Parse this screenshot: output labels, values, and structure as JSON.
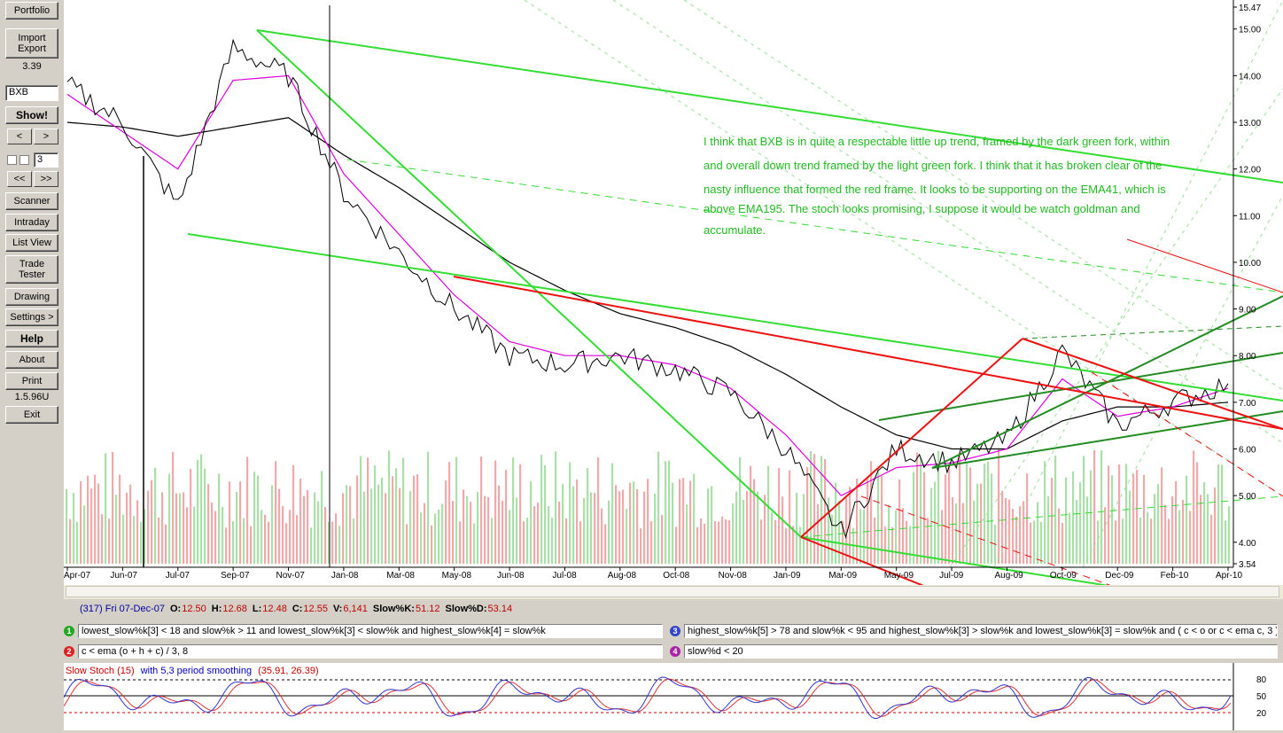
{
  "sidebar": {
    "portfolio": "Portfolio",
    "import_export_1": "Import",
    "import_export_2": "Export",
    "version_top": "3.39",
    "symbol": "BXB",
    "show": "Show!",
    "prev": "<",
    "next": ">",
    "period": "3",
    "first": "<<",
    "last": ">>",
    "scanner": "Scanner",
    "intraday": "Intraday",
    "list_view": "List View",
    "trade_tester_1": "Trade",
    "trade_tester_2": "Tester",
    "drawing": "Drawing",
    "settings": "Settings >",
    "help": "Help",
    "about": "About",
    "print": "Print",
    "version_bottom": "1.5.96U",
    "exit": "Exit"
  },
  "chart": {
    "annotation": [
      "I think that BXB is in quite a respectable little up trend, framed by the dark green fork, within",
      "and overall down trend framed by the light green fork. I think that it has broken clear of the",
      "nasty influence that formed the red frame. It looks to be supporting on the EMA41, which is",
      "above EMA195. The stoch looks promising, I suppose it would be watch goldman and",
      "accumulate."
    ],
    "price_axis": [
      "15.47",
      "15.00",
      "14.00",
      "13.00",
      "12.00",
      "11.00",
      "10.00",
      "9.00",
      "8.00",
      "7.00",
      "6.00",
      "5.00",
      "4.00",
      "3.54"
    ],
    "date_axis": [
      "Apr-07",
      "Jun-07",
      "Jul-07",
      "Sep-07",
      "Nov-07",
      "Jan-08",
      "Mar-08",
      "May-08",
      "Jun-08",
      "Jul-08",
      "Aug-08",
      "Oct-08",
      "Nov-08",
      "Jan-09",
      "Mar-09",
      "May-09",
      "Jul-09",
      "Aug-09",
      "Oct-09",
      "Dec-09",
      "Feb-10",
      "Apr-10"
    ],
    "colors": {
      "price": "#000000",
      "ema41": "#e000e0",
      "ema195": "#000000",
      "ema_short": "#008000",
      "light_fork": "#33dd33",
      "dark_fork": "#228b22",
      "red_frame": "#ee1111",
      "vol_up": "#a8e0a8",
      "vol_down": "#f0a8a8"
    }
  },
  "chart_data": {
    "type": "line",
    "title": "",
    "xlabel": "",
    "ylabel": "",
    "ylim": [
      3.54,
      15.47
    ],
    "x": [
      "Apr-07",
      "Jun-07",
      "Jul-07",
      "Sep-07",
      "Nov-07",
      "Jan-08",
      "Mar-08",
      "May-08",
      "Jun-08",
      "Jul-08",
      "Aug-08",
      "Oct-08",
      "Nov-08",
      "Jan-09",
      "Mar-09",
      "May-09",
      "Jul-09",
      "Aug-09",
      "Oct-09",
      "Dec-09",
      "Feb-10",
      "Apr-10"
    ],
    "series": [
      {
        "values": [
          13.8,
          13.0,
          11.2,
          14.6,
          14.0,
          11.5,
          10.2,
          9.0,
          8.0,
          7.8,
          8.0,
          7.7,
          7.2,
          6.0,
          4.2,
          6.0,
          5.7,
          6.2,
          8.1,
          6.5,
          7.0,
          7.4
        ]
      },
      {
        "values": [
          13.6,
          12.8,
          12.0,
          13.9,
          14.0,
          11.9,
          10.6,
          9.3,
          8.3,
          8.0,
          8.0,
          7.8,
          7.3,
          6.3,
          5.0,
          5.6,
          5.7,
          6.0,
          7.5,
          6.7,
          6.9,
          7.3
        ]
      },
      {
        "values": [
          13.0,
          12.9,
          12.7,
          12.9,
          13.1,
          12.3,
          11.6,
          10.8,
          10.0,
          9.4,
          8.9,
          8.6,
          8.2,
          7.6,
          6.9,
          6.3,
          6.0,
          6.0,
          6.6,
          6.9,
          6.9,
          7.0
        ]
      }
    ]
  },
  "info": {
    "record": "(317) Fri 07-Dec-07",
    "o_label": "O:",
    "o": "12.50",
    "h_label": "H:",
    "h": "12.68",
    "l_label": "L:",
    "l": "12.48",
    "c_label": "C:",
    "c": "12.55",
    "v_label": "V:",
    "v": "6,141",
    "sk_label": "Slow%K:",
    "sk": "51.12",
    "sd_label": "Slow%D:",
    "sd": "53.14"
  },
  "scans": {
    "s1_num": "1",
    "s1": "lowest_slow%k[3] < 18 and slow%k > 11 and lowest_slow%k[3] < slow%k and highest_slow%k[4] = slow%k",
    "s2_num": "2",
    "s2": "c < ema (o + h + c) / 3, 8",
    "s3_num": "3",
    "s3": "highest_slow%k[5] > 78 and slow%k < 95 and highest_slow%k[3] > slow%k and lowest_slow%k[3] = slow%k  and ( c < o or c < ema c, 3 )",
    "s4_num": "4",
    "s4": "slow%d < 20",
    "badge_colors": {
      "s1": "#22aa22",
      "s2": "#dd2222",
      "s3": "#3344cc",
      "s4": "#aa22aa"
    }
  },
  "stoch": {
    "label_a": "Slow Stoch (15)",
    "label_b": "with 5,3 period smoothing",
    "label_c": "(35.91, 26.39)",
    "axis": [
      "80",
      "50",
      "20"
    ]
  }
}
